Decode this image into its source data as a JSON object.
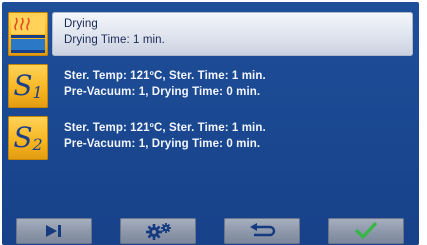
{
  "programs": [
    {
      "id": "drying",
      "icon": "drying-icon",
      "line1": "Drying",
      "line2": "Drying Time: 1 min."
    },
    {
      "id": "s1",
      "icon": "s1-icon",
      "badge_letter": "S",
      "badge_num": "1",
      "line1": "Ster. Temp: 121ºC, Ster. Time: 1 min.",
      "line2": "Pre-Vacuum: 1, Drying Time: 0 min."
    },
    {
      "id": "s2",
      "icon": "s2-icon",
      "badge_letter": "S",
      "badge_num": "2",
      "line1": "Ster. Temp: 121ºC, Ster. Time: 1 min.",
      "line2": "Pre-Vacuum: 1, Drying Time: 0 min."
    }
  ],
  "toolbar": {
    "buttons": [
      {
        "name": "next-button",
        "icon": "skip-next-icon"
      },
      {
        "name": "settings-button",
        "icon": "gears-icon"
      },
      {
        "name": "back-button",
        "icon": "return-icon"
      },
      {
        "name": "confirm-button",
        "icon": "checkmark-icon"
      }
    ]
  },
  "colors": {
    "screen_bg": "#1a4790",
    "tile": "#f6b51f",
    "badge_text": "#1e3f8a",
    "selected_bg": "#dfe4ee",
    "button_bg": "#8d97aa",
    "check": "#39b54a"
  }
}
